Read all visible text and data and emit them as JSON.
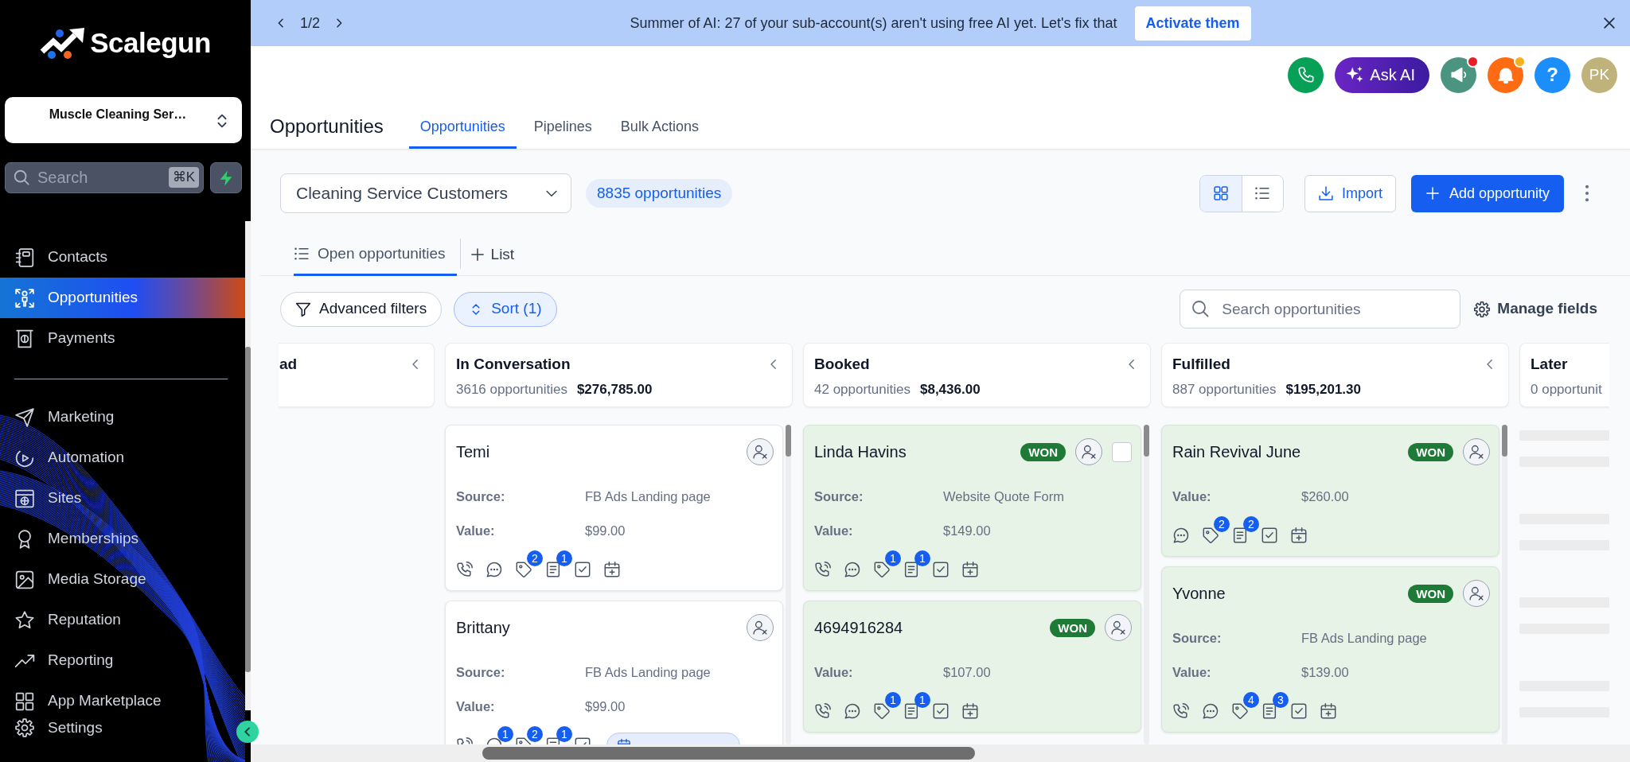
{
  "sidebar": {
    "logo": "Scalegun",
    "account": "Muscle Cleaning Ser…",
    "search": {
      "placeholder": "Search",
      "shortcut": "⌘K"
    },
    "sections": [
      {
        "items": [
          {
            "kind": "contacts",
            "label": "Contacts",
            "selected": false
          },
          {
            "kind": "opportunities",
            "label": "Opportunities",
            "selected": true
          },
          {
            "kind": "payments",
            "label": "Payments",
            "selected": false
          }
        ]
      },
      {
        "items": [
          {
            "kind": "marketing",
            "label": "Marketing",
            "selected": false
          },
          {
            "kind": "automation",
            "label": "Automation",
            "selected": false
          },
          {
            "kind": "sites",
            "label": "Sites",
            "selected": false
          },
          {
            "kind": "memberships",
            "label": "Memberships",
            "selected": false
          },
          {
            "kind": "media_storage",
            "label": "Media Storage",
            "selected": false
          },
          {
            "kind": "reputation",
            "label": "Reputation",
            "selected": false
          },
          {
            "kind": "reporting",
            "label": "Reporting",
            "selected": false
          },
          {
            "kind": "app_marketplace",
            "label": "App Marketplace",
            "selected": false
          }
        ]
      }
    ],
    "footer": {
      "kind": "settings",
      "label": "Settings",
      "selected": false
    }
  },
  "banner": {
    "pager": "1/2",
    "message": "Summer of AI: 27 of your sub-account(s) aren't using free AI yet. Let's fix that",
    "action": "Activate them"
  },
  "header": {
    "actions": [
      {
        "kind": "phone"
      },
      {
        "kind": "ask_ai",
        "label": "Ask AI"
      },
      {
        "kind": "announcements",
        "dot": {
          "color": "#e81e25"
        }
      },
      {
        "kind": "notifications",
        "dot": {
          "color": "#f6b01a"
        }
      },
      {
        "kind": "help",
        "label": "?"
      },
      {
        "kind": "avatar",
        "label": "PK"
      }
    ],
    "title": "Opportunities",
    "tabs": [
      {
        "label": "Opportunities",
        "selected": true
      },
      {
        "label": "Pipelines",
        "selected": false
      },
      {
        "label": "Bulk Actions",
        "selected": false
      }
    ]
  },
  "toolbar": {
    "pipeline": "Cleaning Service Customers",
    "count": "8835 opportunities",
    "views": [
      {
        "kind": "board",
        "selected": true
      },
      {
        "kind": "list",
        "selected": false
      }
    ],
    "import": "Import",
    "add": "Add opportunity"
  },
  "view_tabs": {
    "tabs": [
      {
        "label": "Open opportunities",
        "selected": true
      }
    ],
    "add": "List"
  },
  "filters": {
    "advanced": "Advanced filters",
    "sort": {
      "label": "Sort (1)",
      "active": true
    },
    "search_placeholder": "Search opportunities",
    "manage": "Manage fields"
  },
  "board": {
    "columns": [
      {
        "kind": "clipped_start",
        "title": "ad",
        "loading": false
      },
      {
        "kind": "full",
        "title": "In Conversation",
        "count": "3616 opportunities",
        "total": "$276,785.00",
        "loading": false,
        "cards": [
          {
            "name": "Temi",
            "fields": [
              {
                "label": "Source:",
                "value": "FB Ads Landing page"
              },
              {
                "label": "Value:",
                "value": "$99.00"
              }
            ],
            "activity": [
              {
                "kind": "call"
              },
              {
                "kind": "chat"
              },
              {
                "kind": "tag",
                "count": "2"
              },
              {
                "kind": "note",
                "count": "1"
              },
              {
                "kind": "task"
              },
              {
                "kind": "appointment"
              }
            ]
          },
          {
            "name": "Brittany",
            "fields": [
              {
                "label": "Source:",
                "value": "FB Ads Landing page"
              },
              {
                "label": "Value:",
                "value": "$99.00"
              }
            ],
            "activity": [
              {
                "kind": "call"
              },
              {
                "kind": "chat",
                "count": "1"
              },
              {
                "kind": "tag",
                "count": "2"
              },
              {
                "kind": "note",
                "count": "1"
              },
              {
                "kind": "task"
              },
              {
                "kind": "date"
              }
            ]
          }
        ]
      },
      {
        "kind": "full",
        "title": "Booked",
        "count": "42 opportunities",
        "total": "$8,436.00",
        "loading": false,
        "cards": [
          {
            "name": "Linda Havins",
            "status": {
              "kind": "won",
              "label": "WON"
            },
            "checkbox": {
              "checked": false
            },
            "fields": [
              {
                "label": "Source:",
                "value": "Website Quote Form"
              },
              {
                "label": "Value:",
                "value": "$149.00"
              }
            ],
            "activity": [
              {
                "kind": "call"
              },
              {
                "kind": "chat"
              },
              {
                "kind": "tag",
                "count": "1"
              },
              {
                "kind": "note",
                "count": "1"
              },
              {
                "kind": "task"
              },
              {
                "kind": "appointment"
              }
            ]
          },
          {
            "name": "4694916284",
            "status": {
              "kind": "won",
              "label": "WON"
            },
            "fields": [
              {
                "label": "Value:",
                "value": "$107.00"
              }
            ],
            "activity": [
              {
                "kind": "call"
              },
              {
                "kind": "chat"
              },
              {
                "kind": "tag",
                "count": "1"
              },
              {
                "kind": "note",
                "count": "1"
              },
              {
                "kind": "task"
              },
              {
                "kind": "appointment"
              }
            ]
          }
        ]
      },
      {
        "kind": "full",
        "title": "Fulfilled",
        "count": "887 opportunities",
        "total": "$195,201.30",
        "loading": false,
        "cards": [
          {
            "name": "Rain Revival June",
            "status": {
              "kind": "won",
              "label": "WON"
            },
            "fields": [
              {
                "label": "Value:",
                "value": "$260.00"
              }
            ],
            "activity": [
              {
                "kind": "chat"
              },
              {
                "kind": "tag",
                "count": "2"
              },
              {
                "kind": "note",
                "count": "2"
              },
              {
                "kind": "task"
              },
              {
                "kind": "appointment"
              }
            ]
          },
          {
            "name": "Yvonne",
            "status": {
              "kind": "won",
              "label": "WON"
            },
            "fields": [
              {
                "label": "Source:",
                "value": "FB Ads Landing page"
              },
              {
                "label": "Value:",
                "value": "$139.00"
              }
            ],
            "activity": [
              {
                "kind": "call"
              },
              {
                "kind": "chat"
              },
              {
                "kind": "tag",
                "count": "4"
              },
              {
                "kind": "note",
                "count": "3"
              },
              {
                "kind": "task"
              },
              {
                "kind": "appointment"
              }
            ]
          }
        ]
      },
      {
        "kind": "clipped_end",
        "title": "Later",
        "count": "0 opportunit",
        "loading": true
      }
    ]
  }
}
